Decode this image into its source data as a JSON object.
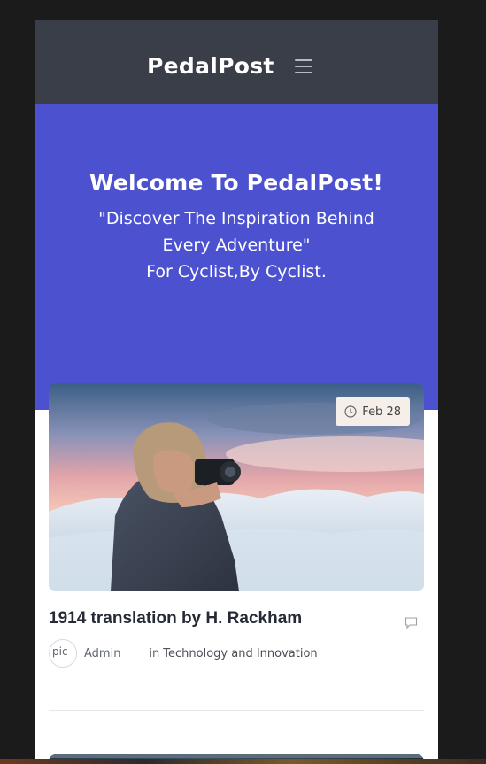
{
  "header": {
    "brand": "PedalPost",
    "menu_icon": "hamburger-icon"
  },
  "hero": {
    "title": "Welcome To PedalPost!",
    "quote": "\"Discover The Inspiration Behind Every Adventure\"",
    "subtitle": "For Cyclist,By Cyclist."
  },
  "colors": {
    "navbar": "#3a3e48",
    "hero": "#4c51d0",
    "page": "#1b1b1b"
  },
  "post": {
    "date": "Feb 28",
    "date_icon": "clock-icon",
    "title": "1914 translation by H. Rackham",
    "comment_icon": "comment-icon",
    "avatar_alt": "pic",
    "author": "Admin",
    "category_prefix": "in",
    "category": "Technology and Innovation"
  }
}
